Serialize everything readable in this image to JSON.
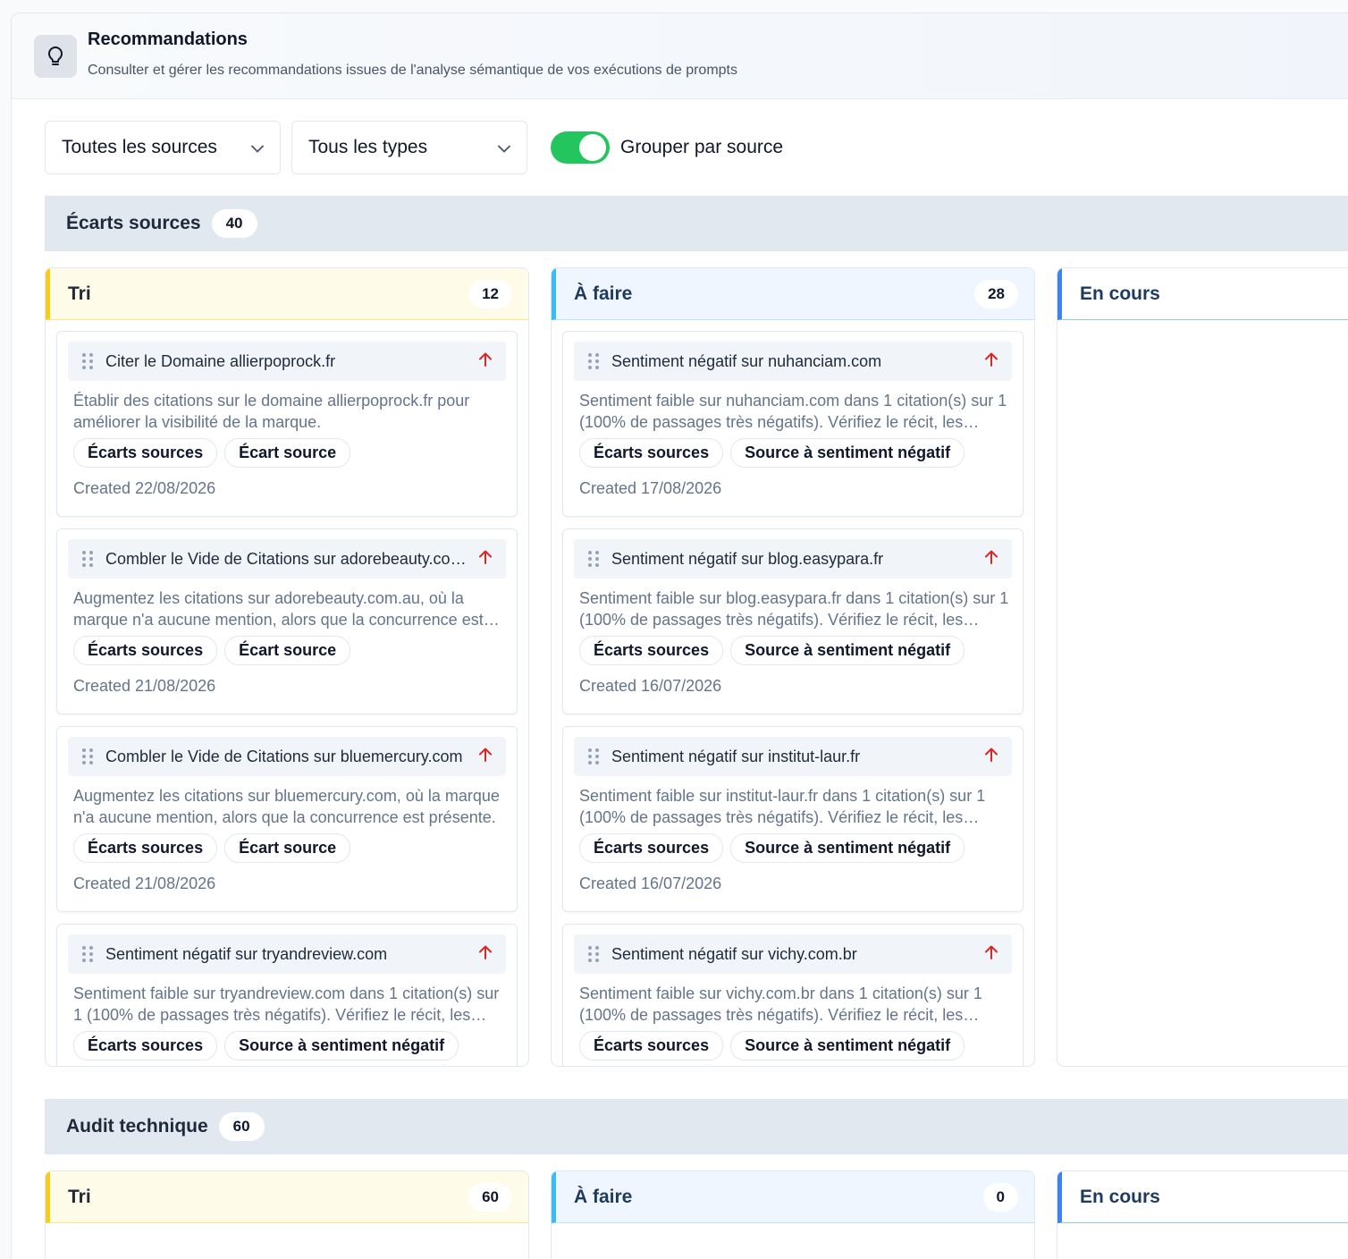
{
  "header": {
    "title": "Recommandations",
    "subtitle": "Consulter et gérer les recommandations issues de l'analyse sémantique de vos exécutions de prompts",
    "icon": "lightbulb-icon"
  },
  "filters": {
    "source_select": "Toutes les sources",
    "type_select": "Tous les types",
    "group_toggle_label": "Grouper par source",
    "group_toggle_on": true
  },
  "colors": {
    "toggle_on": "#22c55e",
    "tri_accent": "#facc15",
    "afaire_accent": "#38bdf8",
    "encours_accent": "#3b82f6",
    "priority_high": "#dc2626"
  },
  "groups": [
    {
      "title": "Écarts sources",
      "count": "40",
      "columns": {
        "tri": {
          "title": "Tri",
          "count": "12",
          "cards": [
            {
              "title": "Citer le Domaine allierpoprock.fr",
              "description": "Établir des citations sur le domaine allierpoprock.fr pour améliorer la visibilité de la marque.",
              "tags": [
                "Écarts sources",
                "Écart source"
              ],
              "created": "Created 22/08/2026"
            },
            {
              "title": "Combler le Vide de Citations sur adorebeauty.com.au",
              "description": "Augmentez les citations sur adorebeauty.com.au, où la marque n'a aucune mention, alors que la concurrence est présente.",
              "tags": [
                "Écarts sources",
                "Écart source"
              ],
              "created": "Created 21/08/2026"
            },
            {
              "title": "Combler le Vide de Citations sur bluemercury.com",
              "description": "Augmentez les citations sur bluemercury.com, où la marque n'a aucune mention, alors que la concurrence est présente.",
              "tags": [
                "Écarts sources",
                "Écart source"
              ],
              "created": "Created 21/08/2026"
            },
            {
              "title": "Sentiment négatif sur tryandreview.com",
              "description": "Sentiment faible sur tryandreview.com dans 1 citation(s) sur 1 (100% de passages très négatifs). Vérifiez le récit, les sources citées.",
              "tags": [
                "Écarts sources",
                "Source à sentiment négatif"
              ],
              "created": ""
            }
          ]
        },
        "afaire": {
          "title": "À faire",
          "count": "28",
          "cards": [
            {
              "title": "Sentiment négatif sur nuhanciam.com",
              "description": "Sentiment faible sur nuhanciam.com dans 1 citation(s) sur 1 (100% de passages très négatifs). Vérifiez le récit, les sources citées.",
              "tags": [
                "Écarts sources",
                "Source à sentiment négatif"
              ],
              "created": "Created 17/08/2026"
            },
            {
              "title": "Sentiment négatif sur blog.easypara.fr",
              "description": "Sentiment faible sur blog.easypara.fr dans 1 citation(s) sur 1 (100% de passages très négatifs). Vérifiez le récit, les sources citées.",
              "tags": [
                "Écarts sources",
                "Source à sentiment négatif"
              ],
              "created": "Created 16/07/2026"
            },
            {
              "title": "Sentiment négatif sur institut-laur.fr",
              "description": "Sentiment faible sur institut-laur.fr dans 1 citation(s) sur 1 (100% de passages très négatifs). Vérifiez le récit, les sources citées.",
              "tags": [
                "Écarts sources",
                "Source à sentiment négatif"
              ],
              "created": "Created 16/07/2026"
            },
            {
              "title": "Sentiment négatif sur vichy.com.br",
              "description": "Sentiment faible sur vichy.com.br dans 1 citation(s) sur 1 (100% de passages très négatifs). Vérifiez le récit, les sources citées.",
              "tags": [
                "Écarts sources",
                "Source à sentiment négatif"
              ],
              "created": ""
            }
          ]
        },
        "encours": {
          "title": "En cours"
        }
      }
    },
    {
      "title": "Audit technique",
      "count": "60",
      "columns": {
        "tri": {
          "title": "Tri",
          "count": "60"
        },
        "afaire": {
          "title": "À faire",
          "count": "0"
        },
        "encours": {
          "title": "En cours"
        }
      }
    }
  ]
}
